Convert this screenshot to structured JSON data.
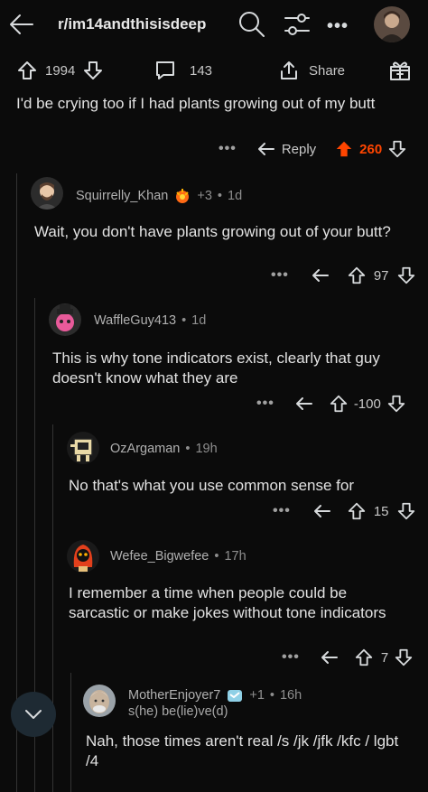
{
  "header": {
    "subreddit": "r/im14andthisisdeep",
    "more_label": "•••"
  },
  "post": {
    "upvotes": "1994",
    "comments": "143",
    "share_label": "Share"
  },
  "comments": [
    {
      "text": "I'd be crying too if I had plants growing out of my butt",
      "reply_label": "Reply",
      "score": "260",
      "more": "•••"
    },
    {
      "username": "Squirrelly_Khan",
      "award_count": "+3",
      "age": "1d",
      "text": "Wait, you don't have plants growing out of your butt?",
      "score": "97",
      "more": "•••"
    },
    {
      "username": "WaffleGuy413",
      "age": "1d",
      "text": "This is why tone indicators exist, clearly that guy doesn't know what they are",
      "score": "-100",
      "more": "•••"
    },
    {
      "username": "OzArgaman",
      "age": "19h",
      "text": "No that's what you use common sense for",
      "score": "15",
      "more": "•••"
    },
    {
      "username": "Wefee_Bigwefee",
      "age": "17h",
      "text": "I remember a time when people could be sarcastic or make jokes without tone indicators",
      "score": "7",
      "more": "•••"
    },
    {
      "username": "MotherEnjoyer7",
      "award_count": "+1",
      "age": "16h",
      "flair": "s(he) be(lie)ve(d)",
      "text": "Nah, those times aren't real /s /jk /jfk /kfc / lgbt /4"
    }
  ],
  "separator": "•",
  "colors": {
    "background": "#0b0b0b",
    "upvoted": "#ff4500",
    "text": "#d7dadc",
    "muted": "#8e8e8e"
  },
  "icons": [
    "back-arrow-icon",
    "search-icon",
    "filter-icon",
    "upvote-icon",
    "downvote-icon",
    "comment-icon",
    "share-icon",
    "award-icon",
    "reply-icon",
    "chevron-down-icon"
  ]
}
